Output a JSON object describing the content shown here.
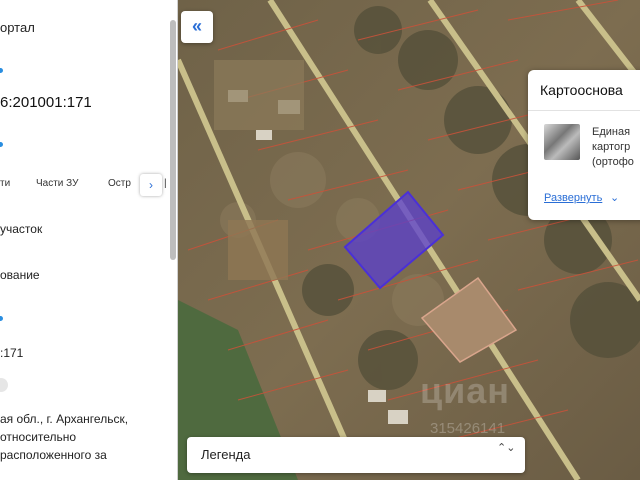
{
  "sidebar": {
    "portal_title": "ортал",
    "cadastral_number": "6:201001:171",
    "tabs": [
      "ти",
      "Части ЗУ",
      "Остр"
    ],
    "tab_more": "|",
    "next_tab_glyph": "›",
    "row_parcel": "участок",
    "row_name": "ование",
    "row_number": ":171",
    "address_lines": [
      "ая обл., г. Архангельск,",
      "относительно",
      "расположенного за"
    ],
    "accent_color": "#2a8ee0"
  },
  "map": {
    "collapse_glyph": "«",
    "selected_parcel_color": "#5a3fcf"
  },
  "basemap": {
    "title": "Картооснова",
    "lines": [
      "Единая",
      "картогр",
      "(ортофо"
    ],
    "more_label": "Развернуть",
    "more_chevron": "⌄"
  },
  "legend": {
    "label": "Легенда",
    "arrows_glyph": "⌃⌄"
  },
  "watermark": {
    "text": "циан",
    "number": "315426141"
  }
}
